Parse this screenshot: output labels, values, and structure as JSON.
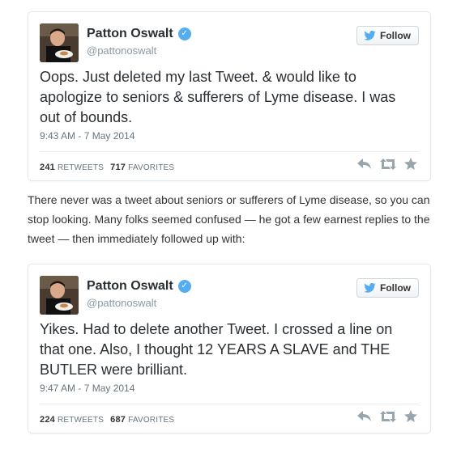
{
  "tweets": [
    {
      "name": "Patton Oswalt",
      "handle": "@pattonoswalt",
      "follow_label": "Follow",
      "text": "Oops. Just deleted my last Tweet. & would like to apologize to seniors & sufferers of Lyme disease. I was out of bounds.",
      "timestamp": "9:43 AM - 7 May 2014",
      "retweets_count": "241",
      "retweets_label": "RETWEETS",
      "favorites_count": "717",
      "favorites_label": "FAVORITES"
    },
    {
      "name": "Patton Oswalt",
      "handle": "@pattonoswalt",
      "follow_label": "Follow",
      "text": "Yikes. Had to delete another Tweet. I crossed a line on that one. Also, I thought 12 YEARS A SLAVE and THE BUTLER were brilliant.",
      "timestamp": "9:47 AM - 7 May 2014",
      "retweets_count": "224",
      "retweets_label": "RETWEETS",
      "favorites_count": "687",
      "favorites_label": "FAVORITES"
    }
  ],
  "explanation": "There never was a tweet about seniors or sufferers of Lyme disease, so you can stop looking. Many folks seemed confused — he got a few earnest replies to the tweet — then immediately followed up with:",
  "colors": {
    "verified": "#55acee",
    "twitter_blue": "#55acee",
    "border": "#e1e8ed"
  },
  "icons": [
    "twitter-bird-icon",
    "verified-icon",
    "reply-icon",
    "retweet-icon",
    "favorite-icon"
  ]
}
